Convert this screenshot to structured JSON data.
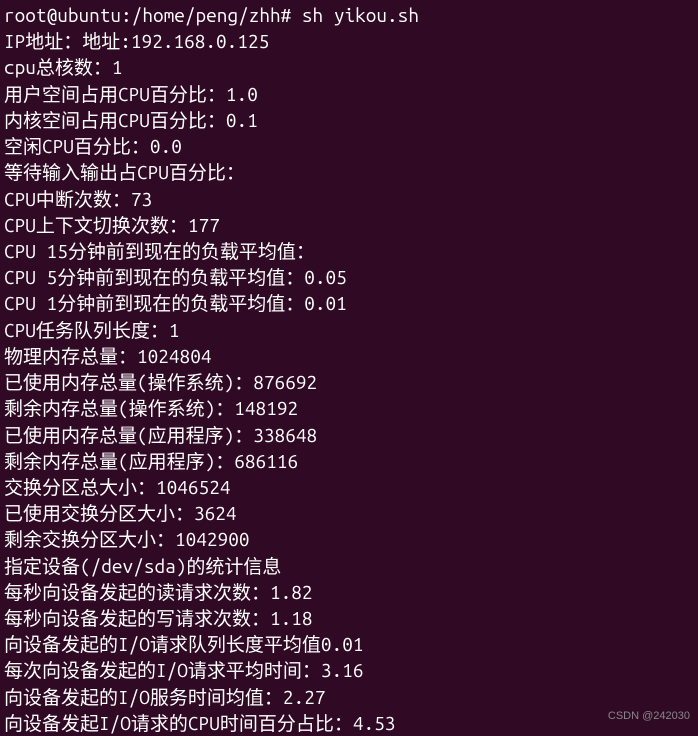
{
  "terminal": {
    "prompt": "root@ubuntu:/home/peng/zhh# sh yikou.sh",
    "lines": [
      "IP地址：地址:192.168.0.125",
      "cpu总核数：1",
      "用户空间占用CPU百分比：1.0",
      "内核空间占用CPU百分比：0.1",
      "空闲CPU百分比：0.0",
      "等待输入输出占CPU百分比：",
      "CPU中断次数：73",
      "CPU上下文切换次数：177",
      "CPU 15分钟前到现在的负载平均值：",
      "CPU 5分钟前到现在的负载平均值：0.05",
      "CPU 1分钟前到现在的负载平均值：0.01",
      "CPU任务队列长度：1",
      "物理内存总量：1024804",
      "已使用内存总量(操作系统)：876692",
      "剩余内存总量(操作系统)：148192",
      "已使用内存总量(应用程序)：338648",
      "剩余内存总量(应用程序)：686116",
      "交换分区总大小：1046524",
      "已使用交换分区大小：3624",
      "剩余交换分区大小：1042900",
      "指定设备(/dev/sda)的统计信息",
      "每秒向设备发起的读请求次数：1.82",
      "每秒向设备发起的写请求次数：1.18",
      "向设备发起的I/O请求队列长度平均值0.01",
      "每次向设备发起的I/O请求平均时间：3.16",
      "向设备发起的I/O服务时间均值：2.27",
      "向设备发起I/O请求的CPU时间百分占比：4.53"
    ]
  },
  "watermark": "CSDN @242030"
}
